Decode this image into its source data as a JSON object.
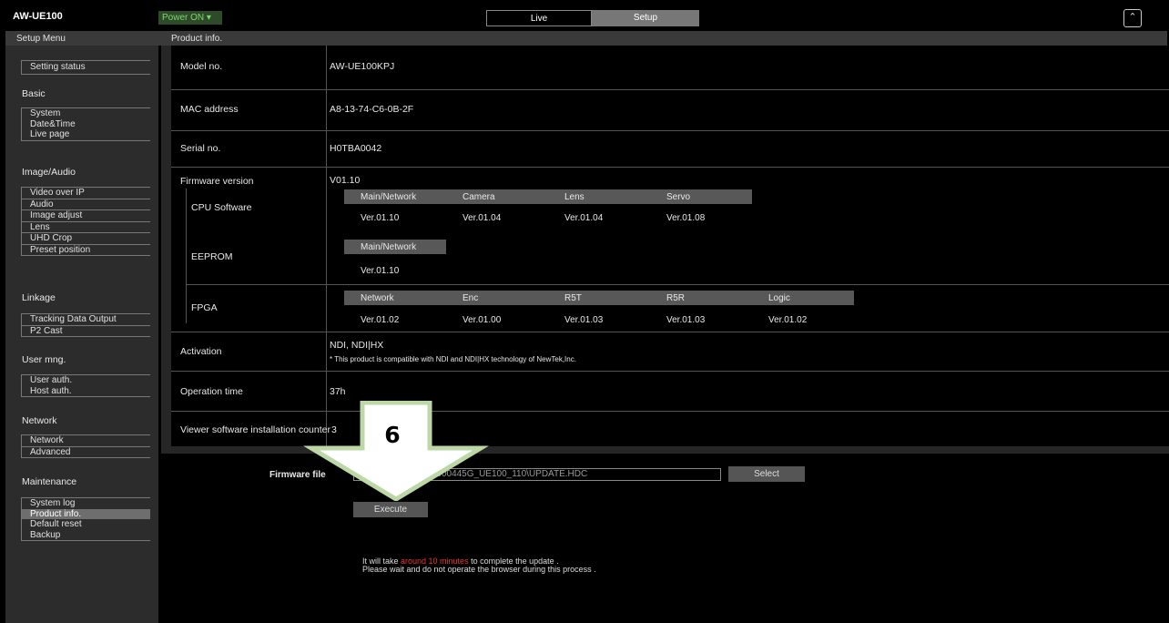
{
  "app": {
    "title": "AW-UE100",
    "power_label": "Power ON",
    "tabs": [
      "Live",
      "Setup"
    ],
    "active_tab": "Setup"
  },
  "header": {
    "setup_menu": "Setup Menu",
    "section_title": "Product info."
  },
  "sidebar": {
    "setting_status": "Setting status",
    "basic": {
      "label": "Basic",
      "items": [
        "System",
        "Date&Time",
        "Live page"
      ]
    },
    "image_audio": {
      "label": "Image/Audio",
      "items": [
        "Video over IP",
        "Audio",
        "Image adjust",
        "Lens",
        "UHD Crop",
        "Preset position"
      ]
    },
    "linkage": {
      "label": "Linkage",
      "items": [
        "Tracking Data Output",
        "P2 Cast"
      ]
    },
    "user_mng": {
      "label": "User mng.",
      "items": [
        "User auth.",
        "Host auth."
      ]
    },
    "network": {
      "label": "Network",
      "items": [
        "Network",
        "Advanced"
      ]
    },
    "maintenance": {
      "label": "Maintenance",
      "items": [
        "System log",
        "Product info.",
        "Default reset",
        "Backup"
      ],
      "active": "Product info."
    }
  },
  "product": {
    "model_label": "Model no.",
    "model": "AW-UE100KPJ",
    "mac_label": "MAC address",
    "mac": "A8-13-74-C6-0B-2F",
    "serial_label": "Serial no.",
    "serial": "H0TBA0042",
    "firmware_label": "Firmware version",
    "firmware": "V01.10",
    "cpu": {
      "label": "CPU Software",
      "headers": [
        "Main/Network",
        "Camera",
        "Lens",
        "Servo"
      ],
      "values": [
        "Ver.01.10",
        "Ver.01.04",
        "Ver.01.04",
        "Ver.01.08"
      ]
    },
    "eeprom": {
      "label": "EEPROM",
      "headers": [
        "Main/Network"
      ],
      "values": [
        "Ver.01.10"
      ]
    },
    "fpga": {
      "label": "FPGA",
      "headers": [
        "Network",
        "Enc",
        "R5T",
        "R5R",
        "Logic"
      ],
      "values": [
        "Ver.01.02",
        "Ver.01.00",
        "Ver.01.03",
        "Ver.01.03",
        "Ver.01.02"
      ]
    },
    "activation_label": "Activation",
    "activation": "NDI, NDI|HX",
    "activation_note": "* This product is compatible with NDI and NDI|HX technology of NewTek,Inc.",
    "optime_label": "Operation time",
    "optime": "37h",
    "viewer_label": "Viewer software installation counter",
    "viewer": "3"
  },
  "update": {
    "file_label": "Firmware file",
    "file_value": "...\\Downloads\\DV91000445G_UE100_110\\UPDATE.HDC",
    "select_label": "Select",
    "execute_label": "Execute",
    "note_pre": "It will take ",
    "note_highlight": "around 10 minutes",
    "note_post": " to complete the update .",
    "note_line2": "Please wait and do not operate the browser during this process ."
  },
  "annotation": {
    "step": "6"
  },
  "colors": {
    "power_green": "#7ad86a",
    "highlight_red": "#ee3333",
    "arrow_green": "#bcd8a6"
  }
}
